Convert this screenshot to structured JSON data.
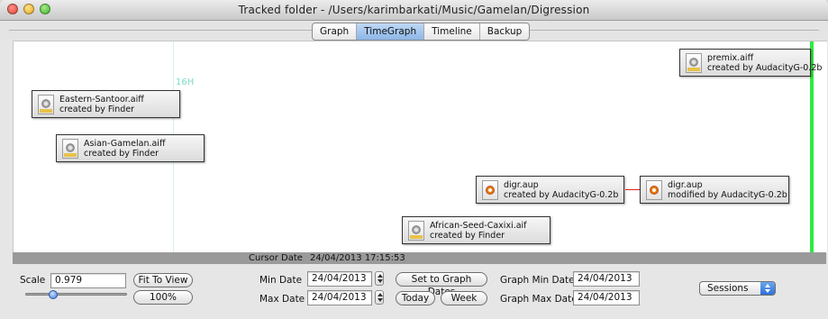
{
  "window": {
    "title": "Tracked folder - /Users/karimbarkati/Music/Gamelan/Digression"
  },
  "tabs": [
    {
      "label": "Graph",
      "active": false
    },
    {
      "label": "TimeGraph",
      "active": true
    },
    {
      "label": "Timeline",
      "active": false
    },
    {
      "label": "Backup",
      "active": false
    }
  ],
  "timegraph": {
    "time_marker": "16H",
    "nodes": [
      {
        "file": "premix.aiff",
        "note": "created by AudacityG-0.2b",
        "icon": "audio-file-icon"
      },
      {
        "file": "Eastern-Santoor.aiff",
        "note": "created by Finder",
        "icon": "audio-file-icon"
      },
      {
        "file": "Asian-Gamelan.aiff",
        "note": "created by Finder",
        "icon": "audio-file-icon"
      },
      {
        "file": "digr.aup",
        "note": "created by AudacityG-0.2b",
        "icon": "audacity-project-icon"
      },
      {
        "file": "digr.aup",
        "note": "modified by AudacityG-0.2b",
        "icon": "audacity-project-icon"
      },
      {
        "file": "African-Seed-Caxixi.aif",
        "note": "created by Finder",
        "icon": "audio-file-icon"
      }
    ],
    "now_line_color": "#2fea3f",
    "arrow_color": "#e02020"
  },
  "status": {
    "cursor_label": "Cursor Date",
    "cursor_value": "24/04/2013 17:15:53"
  },
  "controls": {
    "scale_label": "Scale",
    "scale_value": "0.979",
    "fit_button": "Fit To View",
    "zoom_button": "100%",
    "slider_value": 0.27,
    "min_date_label": "Min Date",
    "min_date_value": "24/04/2013",
    "max_date_label": "Max Date",
    "max_date_value": "24/04/2013",
    "set_graph_dates_button": "Set to Graph Dates",
    "today_button": "Today",
    "week_button": "Week",
    "graph_min_label": "Graph Min Date",
    "graph_min_value": "24/04/2013",
    "graph_max_label": "Graph Max Date",
    "graph_max_value": "24/04/2013",
    "mode_select": "Sessions"
  }
}
